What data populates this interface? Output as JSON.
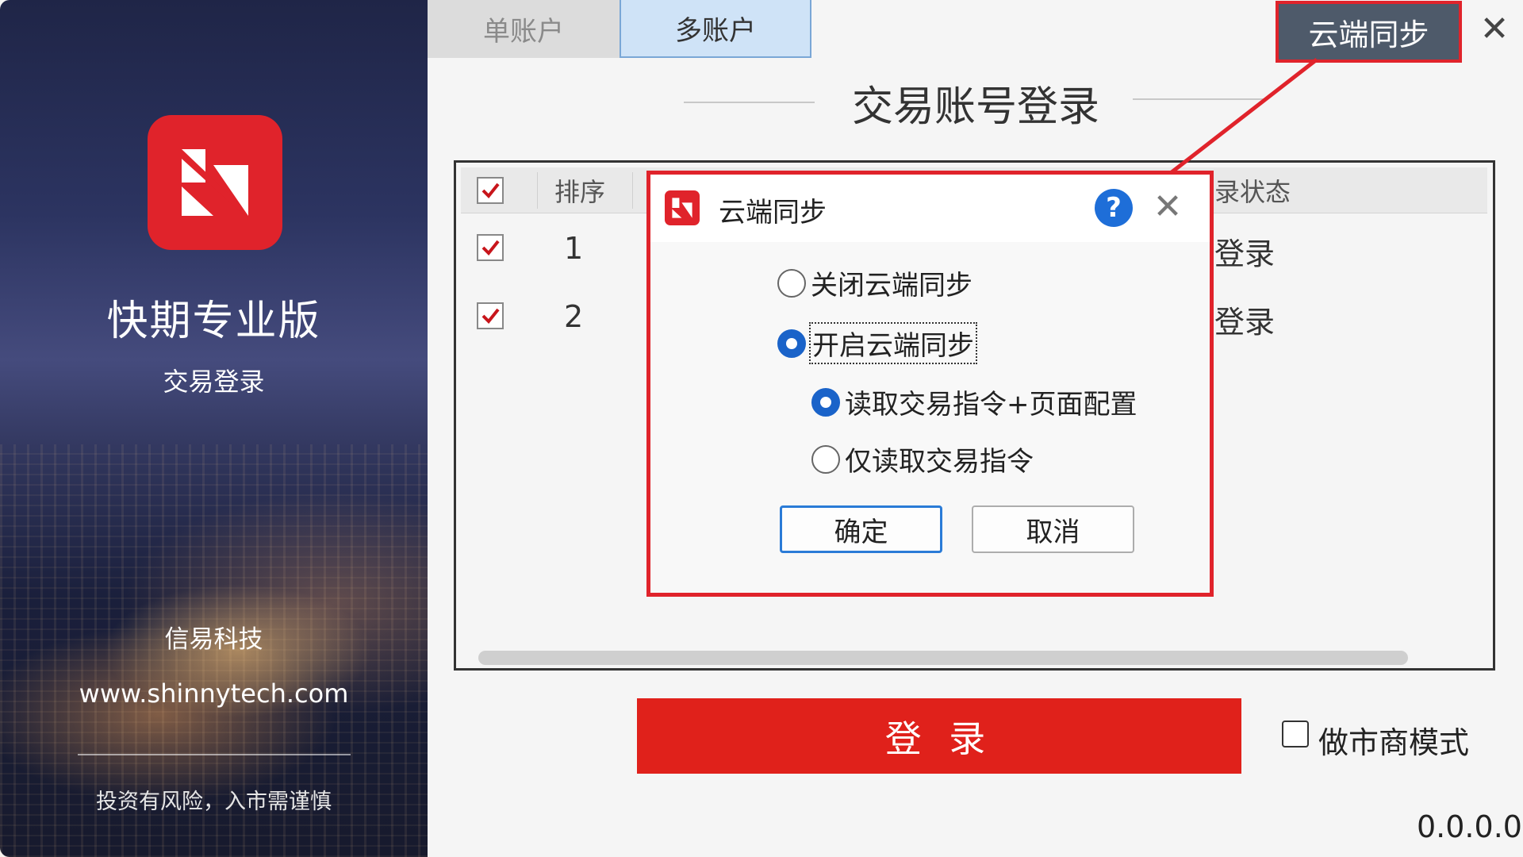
{
  "sidebar": {
    "app_name": "快期专业版",
    "subtitle": "交易登录",
    "company": "信易科技",
    "website": "www.shinnytech.com",
    "risk_notice": "投资有风险，入市需谨慎"
  },
  "tabs": [
    {
      "label": "单账户",
      "active": false
    },
    {
      "label": "多账户",
      "active": true
    }
  ],
  "toolbar": {
    "cloud_sync_label": "云端同步",
    "close_glyph": "✕"
  },
  "page_title": "交易账号登录",
  "table": {
    "columns": [
      "排序",
      "录状态"
    ],
    "rows": [
      {
        "order": "1",
        "status": "登录",
        "checked": true
      },
      {
        "order": "2",
        "status": "登录",
        "checked": true
      }
    ],
    "header_checked": true
  },
  "login_button": "登 录",
  "market_maker": {
    "label": "做市商模式",
    "checked": false
  },
  "version": "0.0.0.0",
  "dialog": {
    "title": "云端同步",
    "help_glyph": "?",
    "close_glyph": "✕",
    "options": [
      {
        "label": "关闭云端同步",
        "selected": false
      },
      {
        "label": "开启云端同步",
        "selected": true
      }
    ],
    "sub_options": [
      {
        "label": "读取交易指令+页面配置",
        "selected": true
      },
      {
        "label": "仅读取交易指令",
        "selected": false
      }
    ],
    "ok_label": "确定",
    "cancel_label": "取消"
  },
  "colors": {
    "brand_red": "#e0232b",
    "accent_blue": "#1a63c9",
    "cloud_button": "#4e5a6a"
  }
}
